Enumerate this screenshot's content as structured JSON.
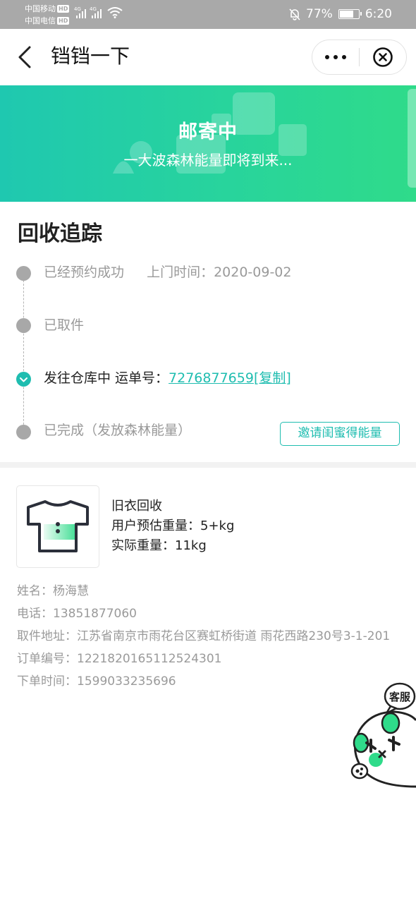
{
  "status_bar": {
    "carrier1": "中国移动",
    "carrier2": "中国电信",
    "hd": "HD",
    "network": "4G",
    "battery_text": "77%",
    "battery_level": 0.77,
    "time": "6:20"
  },
  "nav": {
    "title": "铛铛一下"
  },
  "banner": {
    "title": "邮寄中",
    "subtitle": "一大波森林能量即将到来..."
  },
  "tracking": {
    "heading": "回收追踪",
    "steps": [
      {
        "label": "已经预约成功",
        "extra": "上门时间：2020-09-02"
      },
      {
        "label": "已取件"
      },
      {
        "label": "发往仓库中 运单号：",
        "waybill": "7276877659",
        "copy": "[复制]"
      },
      {
        "label": "已完成（发放森林能量）"
      }
    ],
    "invite_button": "邀请闺蜜得能量"
  },
  "product": {
    "name": "旧衣回收",
    "estimated_weight": "用户预估重量：5+kg",
    "actual_weight": "实际重量：11kg"
  },
  "details": {
    "name": "姓名：杨海慧",
    "phone": "电话：13851877060",
    "address": "取件地址：江苏省南京市雨花台区赛虹桥街道 雨花西路230号3-1-201",
    "order_no": "订单编号：1221820165112524301",
    "order_time": "下单时间：1599033235696"
  },
  "customer_service": {
    "label": "客服"
  },
  "colors": {
    "accent": "#1fbdb0",
    "banner_start": "#1fc8b0",
    "banner_end": "#2fdb8a",
    "status_bar": "#a9a9a9"
  }
}
